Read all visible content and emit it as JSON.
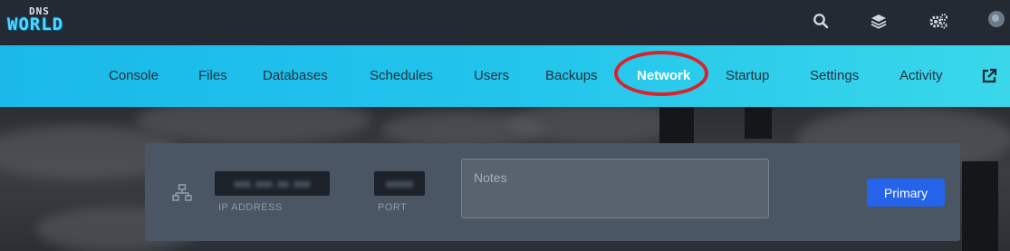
{
  "brand": {
    "logo_top": "DNS",
    "logo_bottom": "WORLD"
  },
  "topbar": {
    "icons": [
      "search-icon",
      "layers-icon",
      "cogs-icon",
      "avatar"
    ]
  },
  "nav": {
    "items": [
      {
        "label": "Console"
      },
      {
        "label": "Files"
      },
      {
        "label": "Databases"
      },
      {
        "label": "Schedules"
      },
      {
        "label": "Users"
      },
      {
        "label": "Backups"
      },
      {
        "label": "Network",
        "active": true
      },
      {
        "label": "Startup"
      },
      {
        "label": "Settings"
      },
      {
        "label": "Activity"
      }
    ],
    "external_icon": "external-link-icon"
  },
  "allocation": {
    "icon": "network-icon",
    "ip_address": "000.000.00.000",
    "ip_label": "IP ADDRESS",
    "port": "00000",
    "port_label": "PORT",
    "notes_placeholder": "Notes",
    "primary_label": "Primary"
  },
  "colors": {
    "accent": "#1ab9ea",
    "primary_button": "#2563eb",
    "highlight": "#d8232a",
    "card": "#4a5663"
  }
}
